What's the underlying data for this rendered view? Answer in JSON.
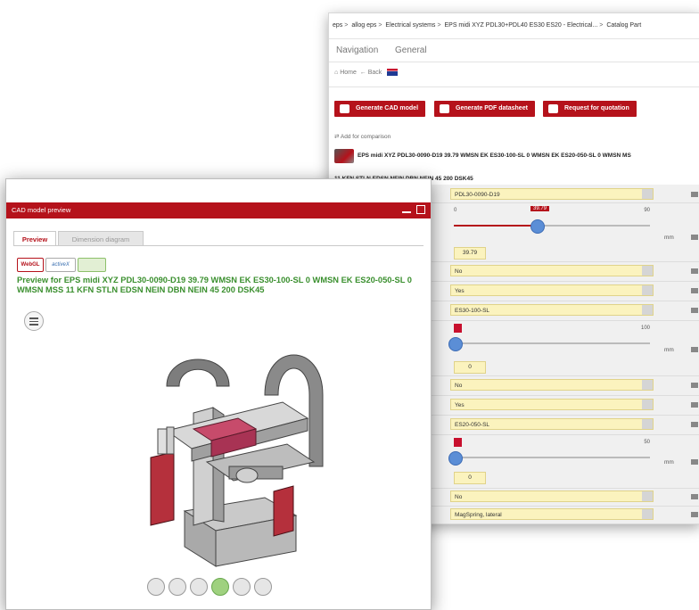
{
  "catalog_window": {
    "breadcrumb": [
      "eps",
      "allog eps",
      "Electrical systems",
      "EPS midi XYZ PDL30+PDL40 ES30 ES20 - Electrical...",
      "Catalog Part"
    ],
    "nav_tabs": [
      "Navigation",
      "General"
    ],
    "home_label": "Home",
    "back_label": "Back",
    "buttons": [
      "Generate CAD model",
      "Generate PDF datasheet",
      "Request for quotation"
    ],
    "compare_label": "Add for comparison",
    "product_title_line1": "EPS midi XYZ PDL30-0090-D19 39.79 WMSN EK ES30-100-SL 0 WMSN EK ES20-050-SL 0 WMSN MS",
    "product_title_line2": "11 KFN STLN EDSN NEIN DBN NEIN 45 200 DSK45",
    "params": {
      "p1": "PDL30-0090-D19",
      "slider1_min": "0",
      "slider1_max": "90",
      "slider1_value": "39.79",
      "slider1_input": "39.79",
      "unit": "mm",
      "p2": "No",
      "p3": "Yes",
      "p4": "ES30-100-SL",
      "slider2_max": "100",
      "slider2_input": "0",
      "p5": "No",
      "p6": "Yes",
      "p7": "ES20-050-SL",
      "slider3_max": "50",
      "slider3_input": "0",
      "p8": "No",
      "p9": "MagSpring, lateral"
    }
  },
  "cad_window": {
    "title": "CAD model preview",
    "tabs": [
      "Preview",
      "Dimension diagram"
    ],
    "logos": [
      "WebGL",
      "activeX",
      ""
    ],
    "preview_title": "Preview for EPS midi XYZ PDL30-0090-D19 39.79 WMSN EK ES30-100-SL 0 WMSN EK ES20-050-SL 0 WMSN MSS 11 KFN STLN EDSN NEIN DBN NEIN 45 200 DSK45",
    "bottom_icons": [
      "solid-view-icon",
      "hidden-line-icon",
      "wireframe-icon",
      "shaded-icon",
      "section-icon",
      "transparent-icon"
    ]
  }
}
